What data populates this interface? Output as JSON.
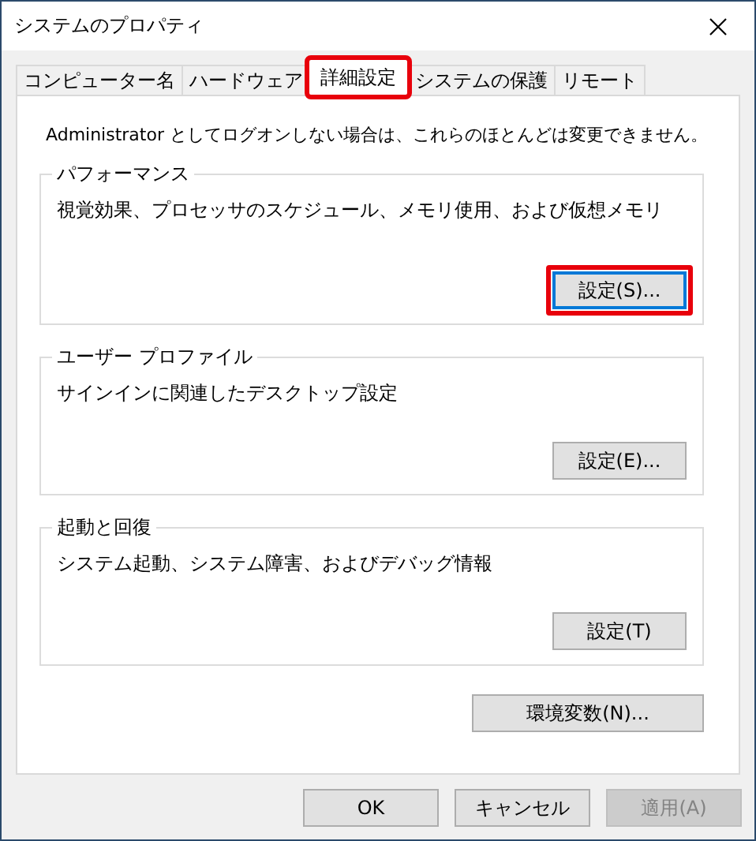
{
  "window": {
    "title": "システムのプロパティ"
  },
  "tabs": [
    {
      "label": "コンピューター名",
      "selected": false,
      "highlighted": false
    },
    {
      "label": "ハードウェア",
      "selected": false,
      "highlighted": false
    },
    {
      "label": "詳細設定",
      "selected": true,
      "highlighted": true
    },
    {
      "label": "システムの保護",
      "selected": false,
      "highlighted": false
    },
    {
      "label": "リモート",
      "selected": false,
      "highlighted": false
    }
  ],
  "notice": "Administrator としてログオンしない場合は、これらのほとんどは変更できません。",
  "groups": [
    {
      "title": "パフォーマンス",
      "description": "視覚効果、プロセッサのスケジュール、メモリ使用、および仮想メモリ",
      "button": {
        "label": "設定(S)...",
        "focused": true,
        "highlighted": true
      }
    },
    {
      "title": "ユーザー プロファイル",
      "description": "サインインに関連したデスクトップ設定",
      "button": {
        "label": "設定(E)...",
        "focused": false,
        "highlighted": false
      }
    },
    {
      "title": "起動と回復",
      "description": "システム起動、システム障害、およびデバッグ情報",
      "button": {
        "label": "設定(T)",
        "focused": false,
        "highlighted": false
      }
    }
  ],
  "env_button": {
    "label": "環境変数(N)..."
  },
  "footer_buttons": [
    {
      "label": "OK",
      "disabled": false
    },
    {
      "label": "キャンセル",
      "disabled": false
    },
    {
      "label": "適用(A)",
      "disabled": true
    }
  ]
}
